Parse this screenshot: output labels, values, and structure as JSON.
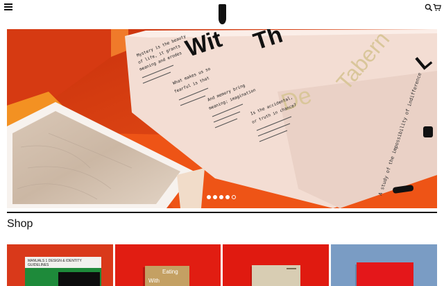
{
  "header": {
    "menu_icon": "hamburger-menu-icon",
    "logo": "brand-logo-mark",
    "search_icon": "search-icon",
    "cart_icon": "cart-icon"
  },
  "hero": {
    "slide_count": 5,
    "active_slide": 1,
    "book_cover_text": [
      "Wit",
      "Th",
      "De",
      "Tabern",
      "L"
    ],
    "spine_text": "A study of the impossibility of indifference",
    "page_text": [
      "Mystery is the beauty",
      "of life, it grants",
      "meaning and erodes",
      "What makes us so",
      "fearful is that",
      "And memory bring",
      "meaning; imagination",
      "Is the accidental,",
      "or truth in chance?"
    ]
  },
  "shop": {
    "title": "Shop",
    "products": [
      {
        "cover_text": "MANUALS 1 DESIGN & IDENTITY GUIDELINES"
      },
      {
        "cover_text_1": "Eating",
        "cover_text_2": "With"
      },
      {
        "cover_text": ""
      },
      {
        "cover_text": ""
      }
    ]
  },
  "colors": {
    "accent_orange": "#e64415",
    "accent_red": "#e11d12",
    "sky_blue": "#7a9cc4",
    "text": "#111111"
  }
}
